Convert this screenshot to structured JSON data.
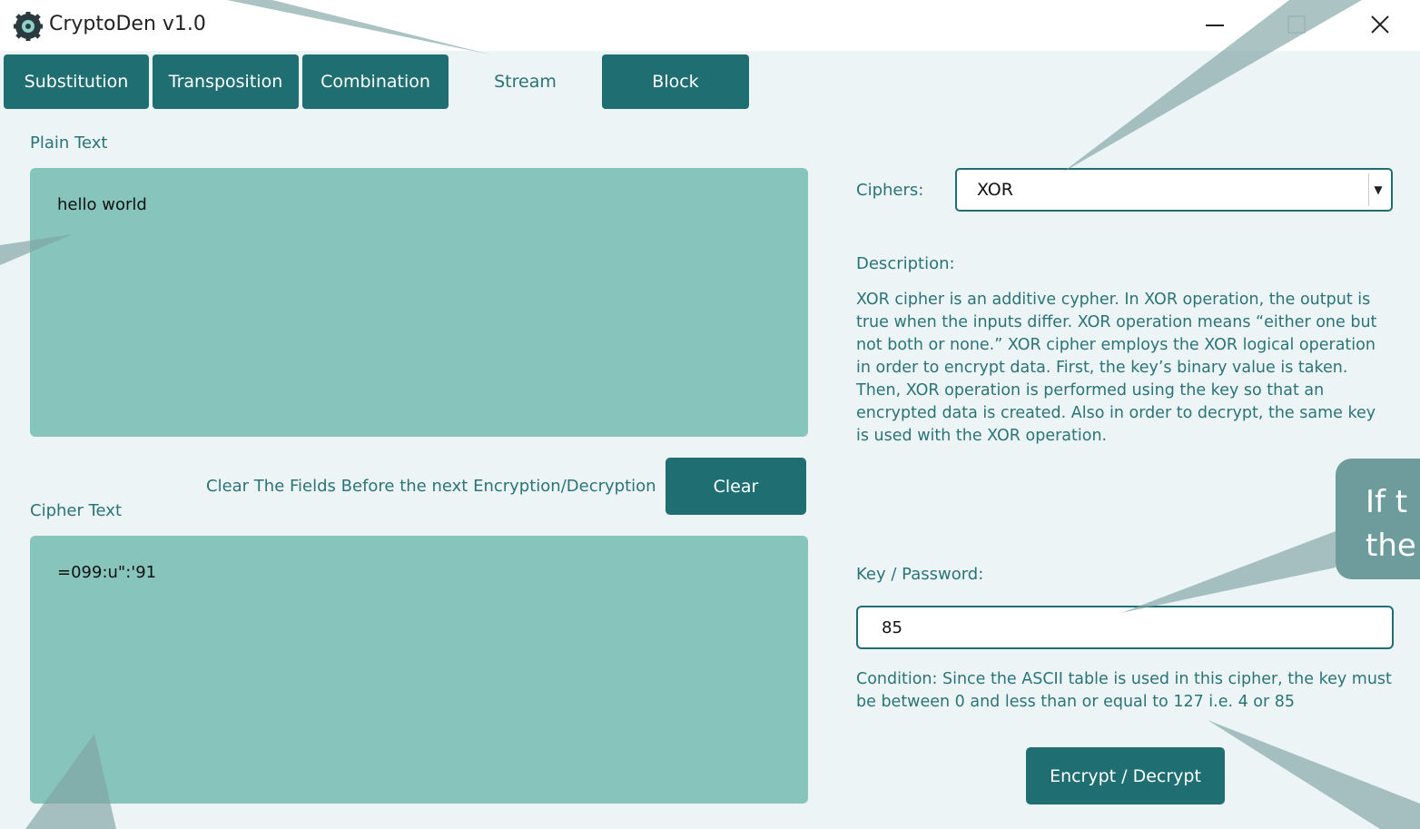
{
  "window": {
    "title": "CryptoDen v1.0",
    "icons": [
      "app-gear-icon",
      "minimize-icon",
      "maximize-icon",
      "close-icon"
    ]
  },
  "tabs": [
    {
      "label": "Substitution",
      "active": false
    },
    {
      "label": "Transposition",
      "active": false
    },
    {
      "label": "Combination",
      "active": false
    },
    {
      "label": "Stream",
      "active": true
    },
    {
      "label": "Block",
      "active": false
    }
  ],
  "left": {
    "plain_label": "Plain Text",
    "plain_value": "hello world",
    "clear_hint": "Clear The Fields Before the next Encryption/Decryption",
    "clear_button": "Clear",
    "cipher_label": "Cipher Text",
    "cipher_value": "=099:u\":'91"
  },
  "right": {
    "ciphers_label": "Ciphers:",
    "cipher_selected": "XOR",
    "description_label": "Description:",
    "description_text": "XOR cipher is an additive cypher. In XOR operation, the output is true when the inputs differ. XOR operation means “either one but not both or none.” XOR cipher employs the XOR logical operation in order to encrypt data. First, the key’s binary value is taken. Then, XOR operation is performed using the key so that an encrypted data is created. Also in order to decrypt, the same key is used with the XOR operation.",
    "key_label": "Key / Password:",
    "key_value": "85",
    "condition_text": "Condition: Since the ASCII table is used in this cipher, the key must be between 0 and less than or equal to 127 i.e. 4 or 85",
    "action_button": "Encrypt / Decrypt"
  },
  "tooltip": {
    "line1": "If t",
    "line2": "the"
  },
  "colors": {
    "primary": "#1f6e72",
    "textarea": "#87c4bc",
    "background": "#ecf4f5",
    "tooltip": "#6e9c9c"
  }
}
